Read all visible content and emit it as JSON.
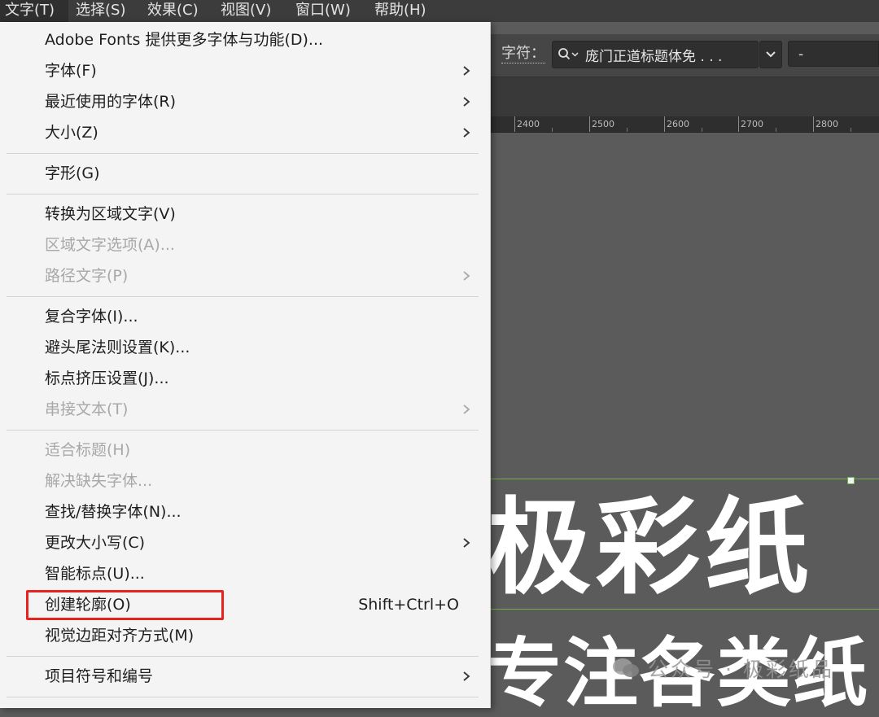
{
  "menubar": {
    "items": [
      {
        "label": "文字(T)",
        "active": true
      },
      {
        "label": "选择(S)"
      },
      {
        "label": "效果(C)"
      },
      {
        "label": "视图(V)"
      },
      {
        "label": "窗口(W)"
      },
      {
        "label": "帮助(H)"
      }
    ]
  },
  "controlbar": {
    "char_label": "字符：",
    "font_name": "庞门正道标题体免 . . .",
    "font_style": "-"
  },
  "ruler": {
    "ticks": [
      "2400",
      "2500",
      "2600",
      "2700",
      "2800"
    ]
  },
  "menu": {
    "items": [
      {
        "label": "Adobe Fonts 提供更多字体与功能(D)..."
      },
      {
        "label": "字体(F)",
        "submenu": true
      },
      {
        "label": "最近使用的字体(R)",
        "submenu": true
      },
      {
        "label": "大小(Z)",
        "submenu": true
      },
      {
        "label": "字形(G)"
      },
      {
        "label": "转换为区域文字(V)"
      },
      {
        "label": "区域文字选项(A)...",
        "disabled": true
      },
      {
        "label": "路径文字(P)",
        "disabled": true,
        "submenu": true
      },
      {
        "label": "复合字体(I)..."
      },
      {
        "label": "避头尾法则设置(K)..."
      },
      {
        "label": "标点挤压设置(J)..."
      },
      {
        "label": "串接文本(T)",
        "disabled": true,
        "submenu": true
      },
      {
        "label": "适合标题(H)",
        "disabled": true
      },
      {
        "label": "解决缺失字体...",
        "disabled": true
      },
      {
        "label": "查找/替换字体(N)..."
      },
      {
        "label": "更改大小写(C)",
        "submenu": true
      },
      {
        "label": "智能标点(U)..."
      },
      {
        "label": "创建轮廓(O)",
        "shortcut": "Shift+Ctrl+O",
        "highlighted": true
      },
      {
        "label": "视觉边距对齐方式(M)"
      },
      {
        "label": "项目符号和编号",
        "submenu": true
      }
    ]
  },
  "canvas": {
    "headline": "极彩纸",
    "subline": "专注各类纸",
    "watermark": "公众号 · 极彩纸品"
  },
  "colors": {
    "highlight": "#e8231f",
    "guide": "#6fae52"
  }
}
